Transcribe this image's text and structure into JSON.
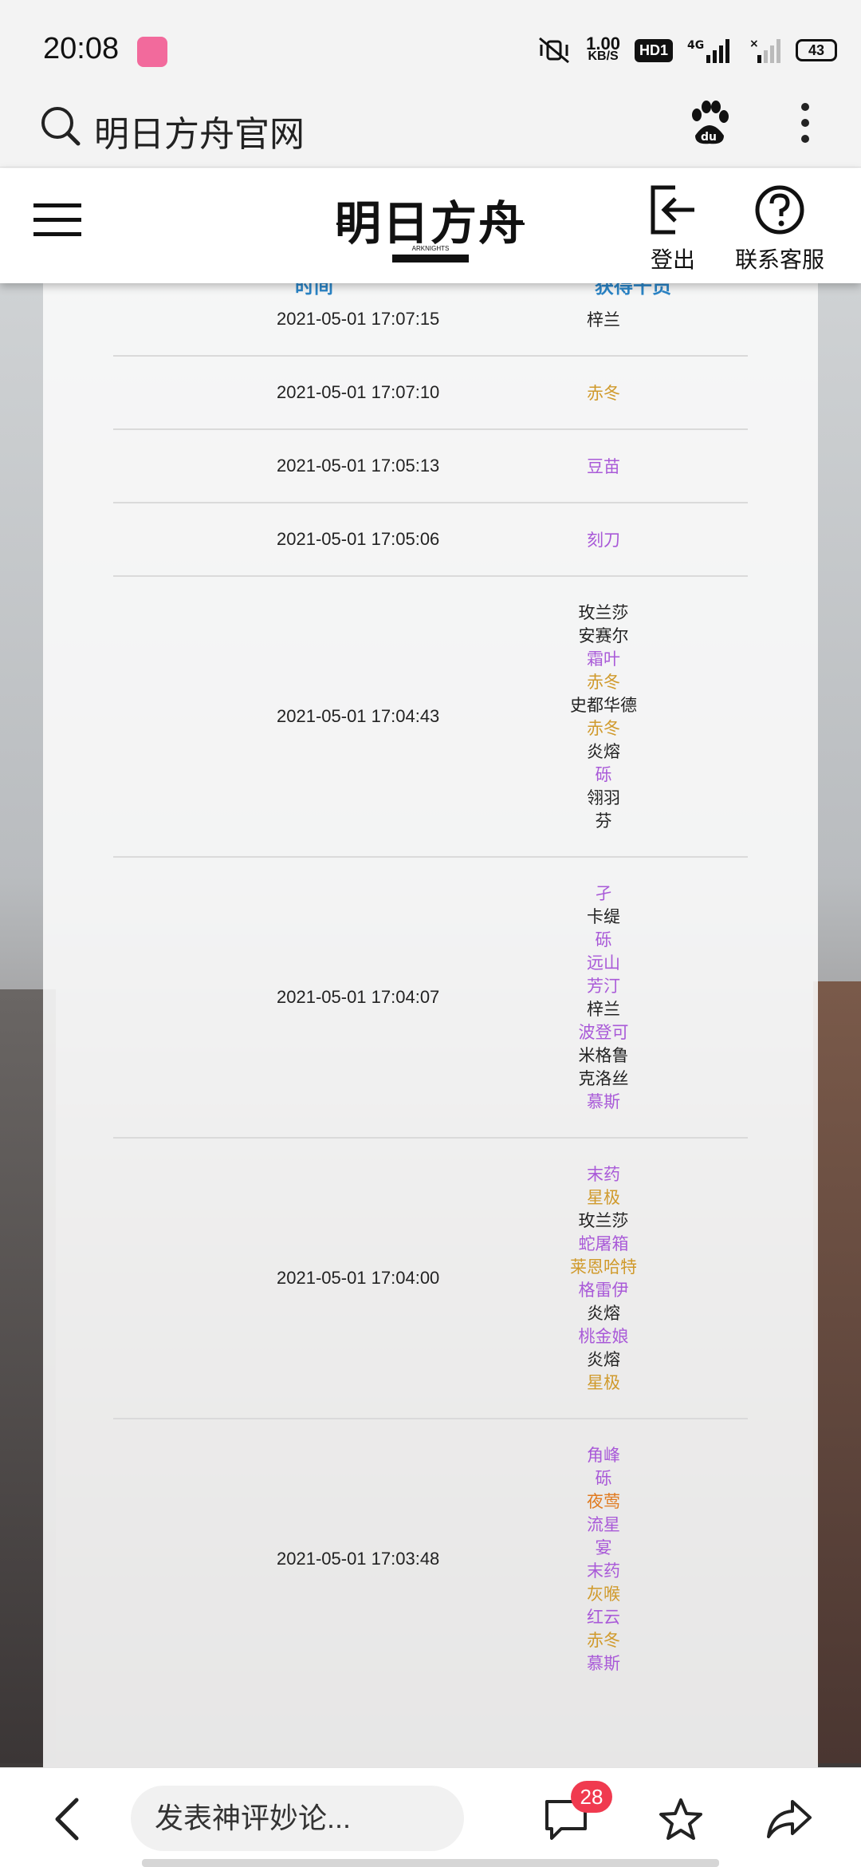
{
  "status": {
    "time": "20:08",
    "speed_value": "1.00",
    "speed_unit": "KB/S",
    "hd": "HD1",
    "network": "4G",
    "battery": "43"
  },
  "search": {
    "query": "明日方舟官网"
  },
  "header": {
    "logo_text": "明日方舟",
    "logo_sub": "ARKNIGHTS",
    "logout_label": "登出",
    "support_label": "联系客服"
  },
  "table": {
    "col_time": "时间",
    "col_result": "获得干员",
    "rows": [
      {
        "time": "2021-05-01 17:07:15",
        "operators": [
          {
            "name": "梓兰",
            "rarity": 3
          }
        ]
      },
      {
        "time": "2021-05-01 17:07:10",
        "operators": [
          {
            "name": "赤冬",
            "rarity": 5
          }
        ]
      },
      {
        "time": "2021-05-01 17:05:13",
        "operators": [
          {
            "name": "豆苗",
            "rarity": 4
          }
        ]
      },
      {
        "time": "2021-05-01 17:05:06",
        "operators": [
          {
            "name": "刻刀",
            "rarity": 4
          }
        ]
      },
      {
        "time": "2021-05-01 17:04:43",
        "operators": [
          {
            "name": "玫兰莎",
            "rarity": 3
          },
          {
            "name": "安赛尔",
            "rarity": 3
          },
          {
            "name": "霜叶",
            "rarity": 4
          },
          {
            "name": "赤冬",
            "rarity": 5
          },
          {
            "name": "史都华德",
            "rarity": 3
          },
          {
            "name": "赤冬",
            "rarity": 5
          },
          {
            "name": "炎熔",
            "rarity": 3
          },
          {
            "name": "砾",
            "rarity": 4
          },
          {
            "name": "翎羽",
            "rarity": 3
          },
          {
            "name": "芬",
            "rarity": 3
          }
        ]
      },
      {
        "time": "2021-05-01 17:04:07",
        "operators": [
          {
            "name": "孑",
            "rarity": 4
          },
          {
            "name": "卡缇",
            "rarity": 3
          },
          {
            "name": "砾",
            "rarity": 4
          },
          {
            "name": "远山",
            "rarity": 4
          },
          {
            "name": "芳汀",
            "rarity": 4
          },
          {
            "name": "梓兰",
            "rarity": 3
          },
          {
            "name": "波登可",
            "rarity": 4
          },
          {
            "name": "米格鲁",
            "rarity": 3
          },
          {
            "name": "克洛丝",
            "rarity": 3
          },
          {
            "name": "慕斯",
            "rarity": 4
          }
        ]
      },
      {
        "time": "2021-05-01 17:04:00",
        "operators": [
          {
            "name": "末药",
            "rarity": 4
          },
          {
            "name": "星极",
            "rarity": 5
          },
          {
            "name": "玫兰莎",
            "rarity": 3
          },
          {
            "name": "蛇屠箱",
            "rarity": 4
          },
          {
            "name": "莱恩哈特",
            "rarity": 5
          },
          {
            "name": "格雷伊",
            "rarity": 4
          },
          {
            "name": "炎熔",
            "rarity": 3
          },
          {
            "name": "桃金娘",
            "rarity": 4
          },
          {
            "name": "炎熔",
            "rarity": 3
          },
          {
            "name": "星极",
            "rarity": 5
          }
        ]
      },
      {
        "time": "2021-05-01 17:03:48",
        "operators": [
          {
            "name": "角峰",
            "rarity": 4
          },
          {
            "name": "砾",
            "rarity": 4
          },
          {
            "name": "夜莺",
            "rarity": 6
          },
          {
            "name": "流星",
            "rarity": 4
          },
          {
            "name": "宴",
            "rarity": 4
          },
          {
            "name": "末药",
            "rarity": 4
          },
          {
            "name": "灰喉",
            "rarity": 5
          },
          {
            "name": "红云",
            "rarity": 4
          },
          {
            "name": "赤冬",
            "rarity": 5
          },
          {
            "name": "慕斯",
            "rarity": 4
          }
        ]
      }
    ]
  },
  "bottom": {
    "comment_placeholder": "发表神评妙论...",
    "comment_count": "28"
  },
  "colors": {
    "rarity_3": "#222222",
    "rarity_4": "#a95ad8",
    "rarity_5": "#d09a2c",
    "rarity_6": "#e07a1f",
    "header_accent": "#2a84c6",
    "badge": "#f03a4f"
  }
}
